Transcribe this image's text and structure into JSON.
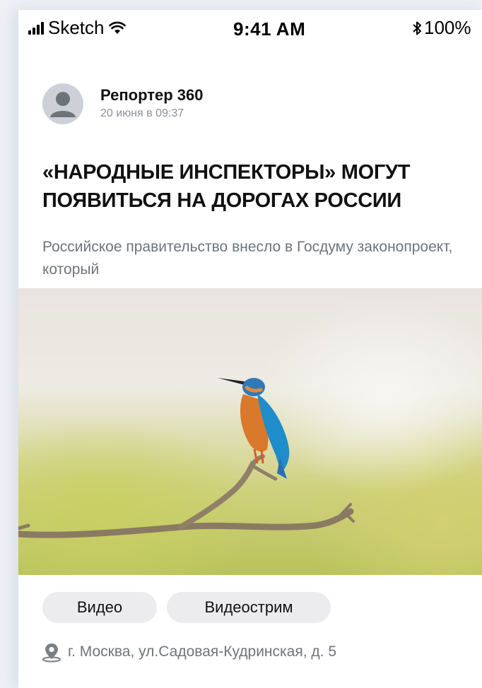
{
  "status_bar": {
    "carrier": "Sketch",
    "time": "9:41 AM",
    "battery": "100%",
    "icons": [
      "signal-icon",
      "wifi-icon",
      "bluetooth-icon"
    ]
  },
  "article": {
    "author": "Репортер 360",
    "date": "20 июня в 09:37",
    "headline_line1": "«НАРОДНЫЕ ИНСПЕКТОРЫ» МОГУТ",
    "headline_line2": "ПОЯВИТЬСЯ НА ДОРОГАХ РОССИИ",
    "lead": "Российское правительство внесло в Госдуму законопроект, который",
    "tags": [
      "Видео",
      "Видеострим"
    ],
    "location": "г. Москва, ул.Садовая-Кудринская, д. 5"
  },
  "colors": {
    "accent": "#3c5bd6",
    "muted_text": "#6f747b",
    "tag_bg": "#ececee"
  }
}
